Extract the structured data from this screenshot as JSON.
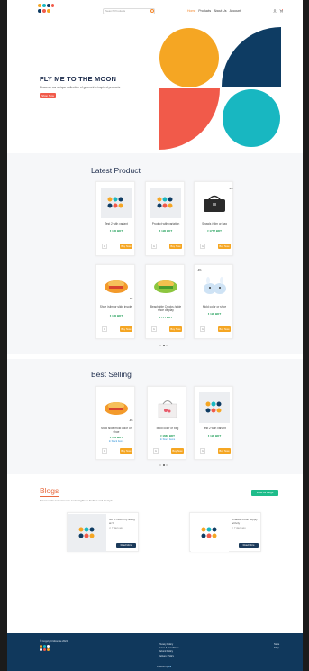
{
  "brand": {
    "colors": {
      "orange": "#f5a623",
      "navy": "#0e3c63",
      "coral": "#f15a4a",
      "teal": "#18b7c1",
      "green": "#1ebc8a"
    }
  },
  "header": {
    "search_placeholder": "Search Products",
    "nav": [
      "Home",
      "Products",
      "About Us",
      "Account"
    ],
    "active_nav": "Home",
    "icons": [
      "search-icon",
      "user-icon",
      "cart-icon"
    ]
  },
  "hero": {
    "title": "FLY ME TO THE MOON",
    "subtitle": "Discover our unique collection of geometric-inspired products",
    "button": "Shop Now"
  },
  "latest": {
    "title": "Latest Product",
    "products": [
      {
        "name": "Test 2 with variant",
        "price": "₫ 190 BDT",
        "buy": "Buy Now",
        "qty": "1",
        "discount": ""
      },
      {
        "name": "Product with variation",
        "price": "₫ 190 BDT",
        "buy": "Buy Now",
        "qty": "1",
        "discount": ""
      },
      {
        "name": "Shawls (slim or bag",
        "price": "₫ 1777 BDT",
        "buy": "Buy Now",
        "qty": "1",
        "discount": "-9%"
      },
      {
        "name": "Shoe (slim or slide insole)",
        "price": "₫ 190 BDT",
        "buy": "Buy Now",
        "qty": "1",
        "discount": "-9%"
      },
      {
        "name": "Beachable Crocks (slide shoe display",
        "price": "₫ 777 BDT",
        "buy": "Buy Now",
        "qty": "1",
        "discount": ""
      },
      {
        "name": "Mold color or shoe",
        "price": "₫ 190 BDT",
        "buy": "Buy Now",
        "qty": "1",
        "discount": "-9%"
      }
    ]
  },
  "best": {
    "title": "Best Selling",
    "products": [
      {
        "name": "Mold slide mold color or shoe",
        "price": "₫ 131 BDT",
        "stock": "In Stock Items",
        "buy": "Buy Now",
        "qty": "1",
        "discount": "-9%"
      },
      {
        "name": "Mold color or bag",
        "price": "₫ 1666 BDT",
        "stock": "In Stock Items",
        "buy": "Buy Now",
        "qty": "1",
        "discount": ""
      },
      {
        "name": "Test 2 with variant",
        "price": "₫ 190 BDT",
        "stock": "",
        "buy": "Buy Now",
        "qty": "1",
        "discount": ""
      }
    ]
  },
  "blogs": {
    "title": "Blogs",
    "subtitle": "Discover the latest trends and insights in fashion and lifestyle",
    "view_all": "View All Blogs",
    "posts": [
      {
        "title": "Go to moon my adfog at %",
        "ago": "7 days ago",
        "button": "Read More"
      },
      {
        "title": "Amasite moon supply activity",
        "ago": "7 days ago",
        "button": "Read More"
      }
    ]
  },
  "footer": {
    "copyright": "© Copyright Moonpie 2024",
    "links": [
      "Privacy Policy",
      "Terms & Conditions",
      "Refund Policy",
      "Delivery Policy"
    ],
    "social": [
      "Store",
      "Shop"
    ],
    "powered": "Powered by"
  }
}
